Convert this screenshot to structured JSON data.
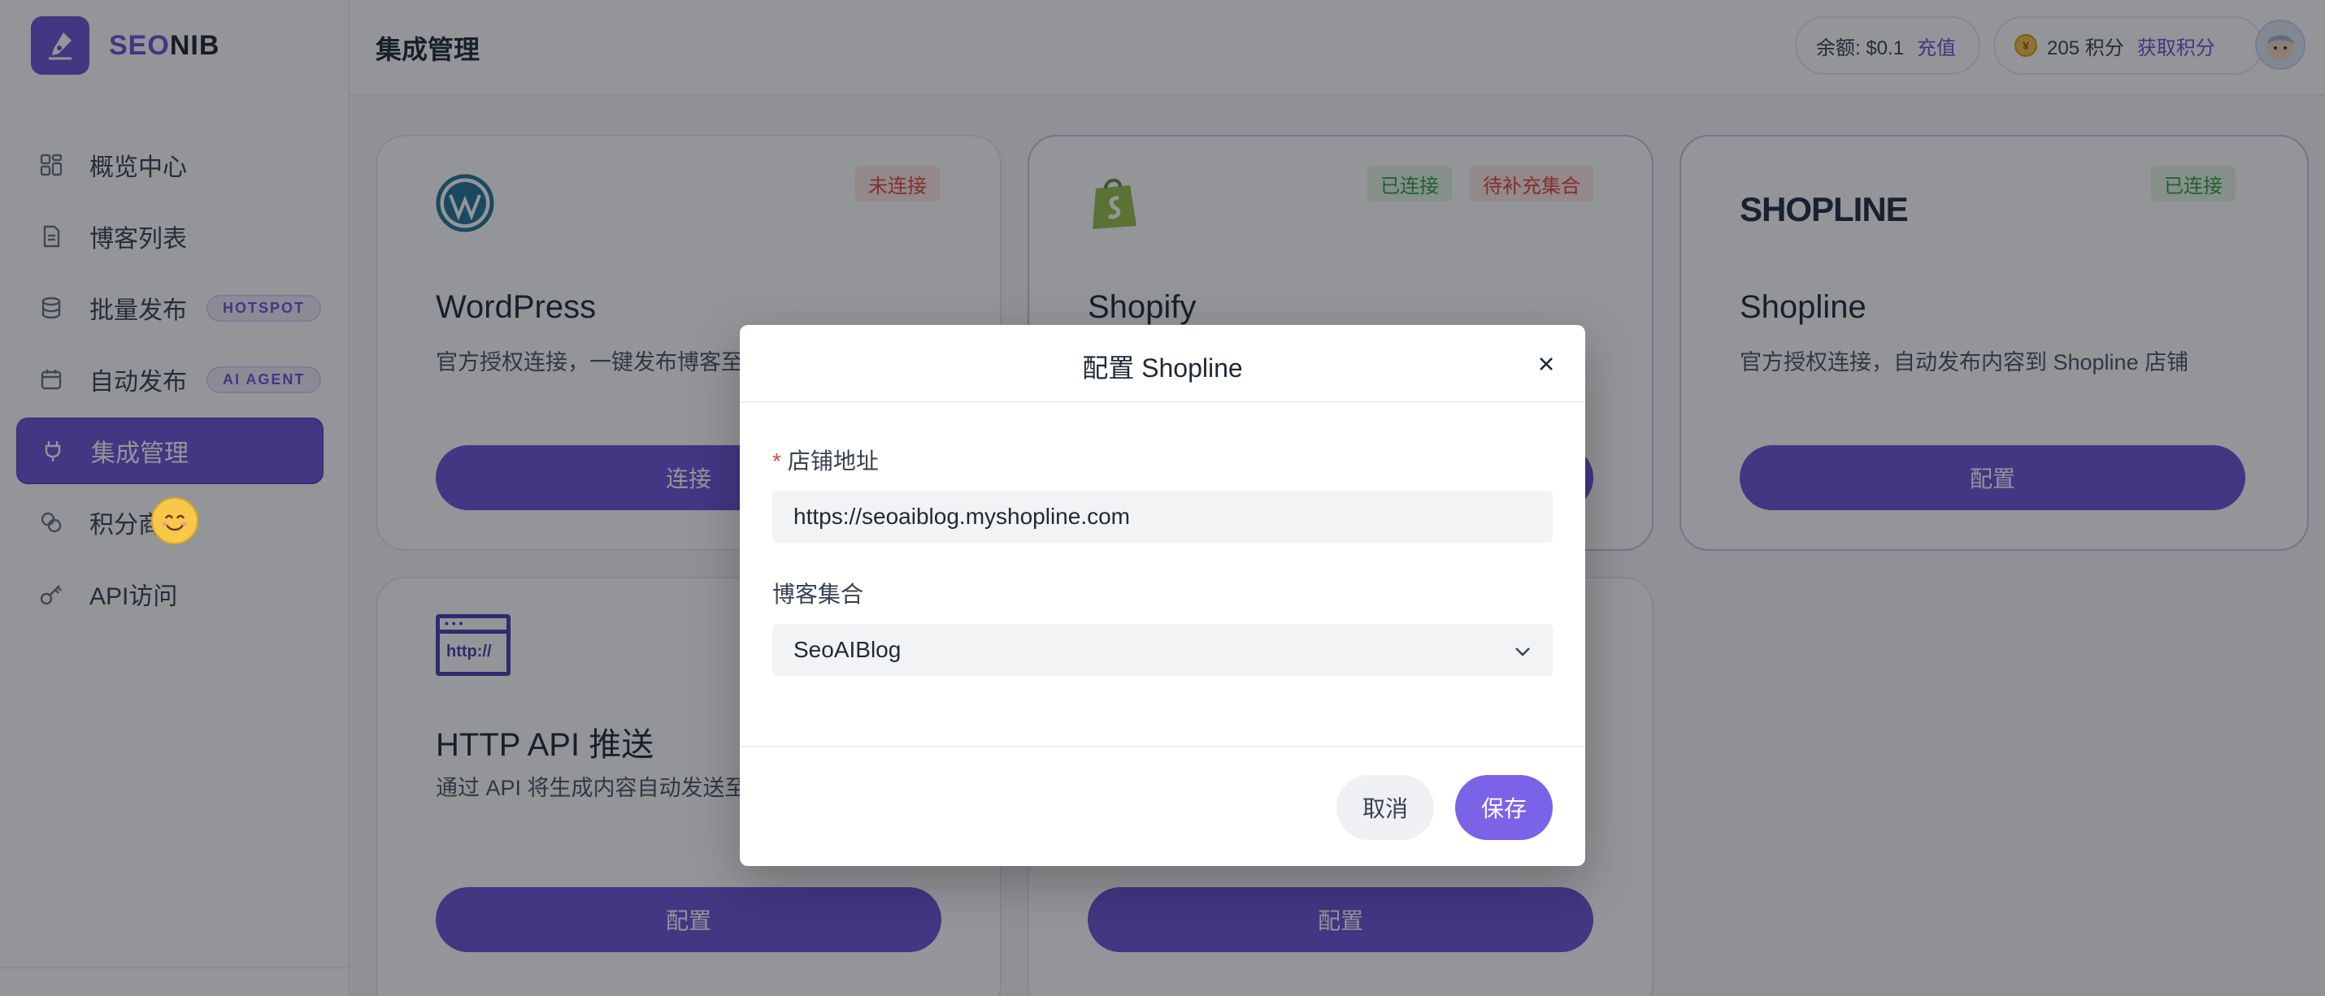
{
  "brand": {
    "name_accent": "SEO",
    "name_rest": "NIB"
  },
  "sidebar": {
    "items": [
      {
        "label": "概览中心",
        "icon": "dashboard-icon"
      },
      {
        "label": "博客列表",
        "icon": "document-icon"
      },
      {
        "label": "批量发布",
        "icon": "database-icon",
        "badge": "HOTSPOT"
      },
      {
        "label": "自动发布",
        "icon": "calendar-icon",
        "badge": "AI AGENT"
      },
      {
        "label": "集成管理",
        "icon": "plug-icon",
        "active": true
      },
      {
        "label": "积分商店",
        "icon": "coins-icon"
      },
      {
        "label": "API访问",
        "icon": "key-icon"
      }
    ]
  },
  "header": {
    "title": "集成管理",
    "balance_label": "余额: $0.1",
    "recharge_link": "充值",
    "points_label": "205 积分",
    "points_link": "获取积分"
  },
  "cards": [
    {
      "name": "WordPress",
      "desc": "官方授权连接，一键发布博客至",
      "button": "连接",
      "tags": [
        "未连接"
      ]
    },
    {
      "name": "Shopify",
      "desc": "",
      "button": "配置",
      "tags": [
        "已连接",
        "待补充集合"
      ]
    },
    {
      "name": "Shopline",
      "desc": "官方授权连接，自动发布内容到 Shopline 店铺",
      "button": "配置",
      "tags": [
        "已连接"
      ],
      "logo_text": "SHOPLINE"
    },
    {
      "name": "HTTP API 推送",
      "desc": "通过 API 将生成内容自动发送至",
      "button": "配置",
      "logo_text": "http://"
    },
    {
      "name": "",
      "desc": "",
      "button": "配置"
    }
  ],
  "modal": {
    "title": "配置 Shopline",
    "store_label": "店铺地址",
    "store_value": "https://seoaiblog.myshopline.com",
    "collection_label": "博客集合",
    "collection_value": "SeoAIBlog",
    "cancel": "取消",
    "save": "保存"
  },
  "colors": {
    "brand": "#6a55d9",
    "overlay": "rgba(18,20,26,0.45)",
    "tag_red_text": "#e0463f",
    "tag_green_text": "#2f9e44",
    "save_button": "#7a63e6"
  }
}
